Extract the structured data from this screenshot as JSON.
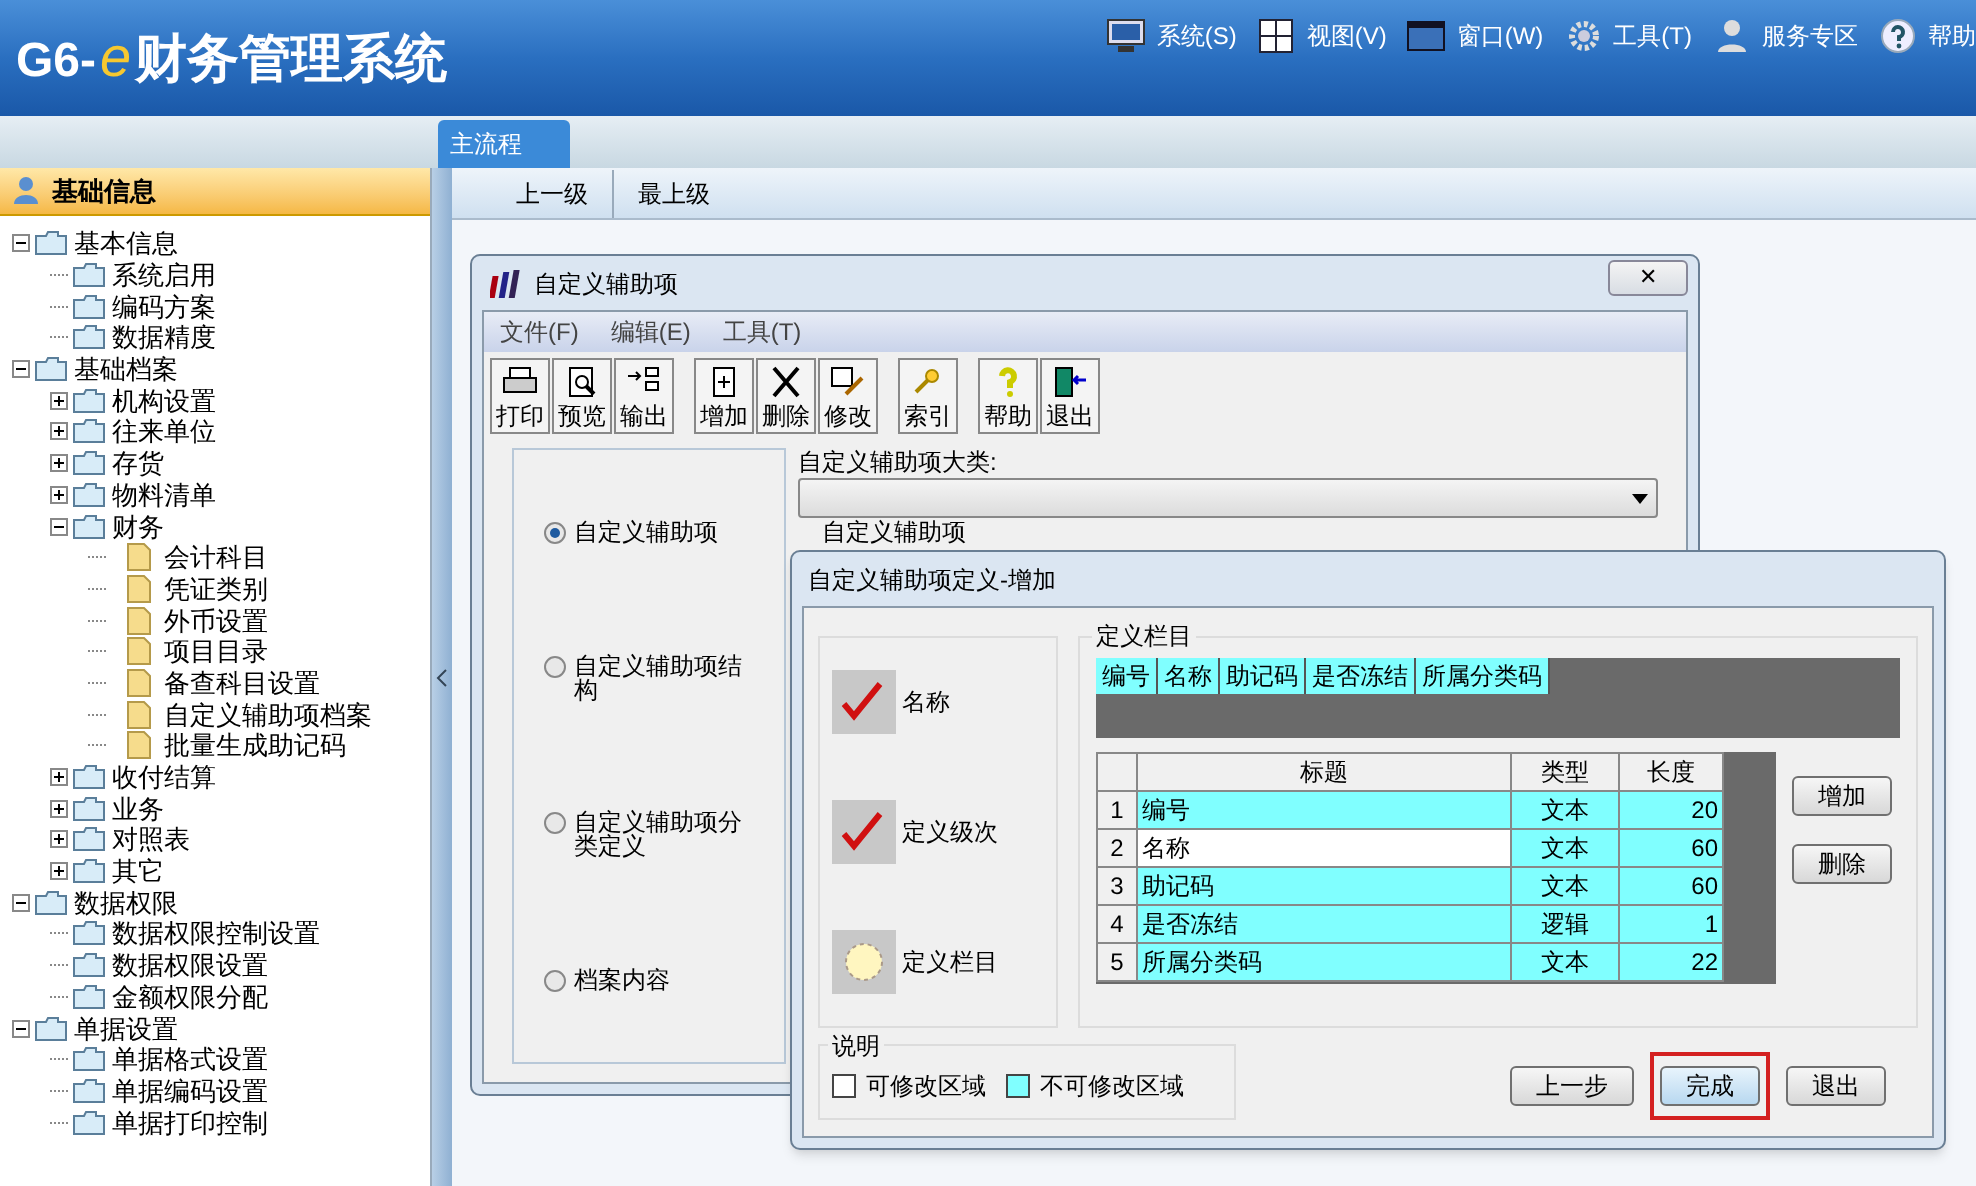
{
  "app": {
    "title_prefix": "G6-",
    "title_e": "e",
    "title": "财务管理系统"
  },
  "menu": [
    "系统(S)",
    "视图(V)",
    "窗口(W)",
    "工具(T)",
    "服务专区",
    "帮助"
  ],
  "tabs": [
    {
      "label": "主流程",
      "selected": true
    }
  ],
  "nav_buttons": [
    "上一级",
    "最上级"
  ],
  "sidebar": {
    "title": "基础信息",
    "tree": [
      {
        "label": "基本信息",
        "kind": "folder",
        "expanded": true,
        "children": [
          {
            "label": "系统启用",
            "kind": "folder"
          },
          {
            "label": "编码方案",
            "kind": "folder"
          },
          {
            "label": "数据精度",
            "kind": "folder"
          }
        ]
      },
      {
        "label": "基础档案",
        "kind": "folder",
        "expanded": true,
        "children": [
          {
            "label": "机构设置",
            "kind": "folder",
            "expanded": false
          },
          {
            "label": "往来单位",
            "kind": "folder",
            "expanded": false
          },
          {
            "label": "存货",
            "kind": "folder",
            "expanded": false
          },
          {
            "label": "物料清单",
            "kind": "folder",
            "expanded": false
          },
          {
            "label": "财务",
            "kind": "folder",
            "expanded": true,
            "children": [
              {
                "label": "会计科目",
                "kind": "document"
              },
              {
                "label": "凭证类别",
                "kind": "document"
              },
              {
                "label": "外币设置",
                "kind": "document"
              },
              {
                "label": "项目目录",
                "kind": "document"
              },
              {
                "label": "备查科目设置",
                "kind": "document"
              },
              {
                "label": "自定义辅助项档案",
                "kind": "document"
              },
              {
                "label": "批量生成助记码",
                "kind": "document"
              }
            ]
          },
          {
            "label": "收付结算",
            "kind": "folder",
            "expanded": false
          },
          {
            "label": "业务",
            "kind": "folder",
            "expanded": false
          },
          {
            "label": "对照表",
            "kind": "folder",
            "expanded": false
          },
          {
            "label": "其它",
            "kind": "folder",
            "expanded": false
          }
        ]
      },
      {
        "label": "数据权限",
        "kind": "folder",
        "expanded": true,
        "children": [
          {
            "label": "数据权限控制设置",
            "kind": "folder"
          },
          {
            "label": "数据权限设置",
            "kind": "folder"
          },
          {
            "label": "金额权限分配",
            "kind": "folder"
          }
        ]
      },
      {
        "label": "单据设置",
        "kind": "folder",
        "expanded": true,
        "children": [
          {
            "label": "单据格式设置",
            "kind": "folder"
          },
          {
            "label": "单据编码设置",
            "kind": "folder"
          },
          {
            "label": "单据打印控制",
            "kind": "folder"
          }
        ]
      }
    ]
  },
  "window": {
    "title": "自定义辅助项",
    "close": "✕",
    "menu": [
      "文件(F)",
      "编辑(E)",
      "工具(T)"
    ],
    "toolbar": [
      [
        "打印",
        "预览",
        "输出"
      ],
      [
        "增加",
        "删除",
        "修改"
      ],
      [
        "索引"
      ],
      [
        "帮助",
        "退出"
      ]
    ],
    "options": [
      {
        "label": "自定义辅助项",
        "selected": true
      },
      {
        "label": "自定义辅助项结构",
        "selected": false
      },
      {
        "label": "自定义辅助项分类定义",
        "selected": false
      },
      {
        "label": "档案内容",
        "selected": false
      }
    ],
    "category_label": "自定义辅助项大类:",
    "group_label": "自定义辅助项"
  },
  "dialog": {
    "title": "自定义辅助项定义-增加",
    "steps": [
      {
        "label": "名称",
        "checked": true
      },
      {
        "label": "定义级次",
        "checked": true
      },
      {
        "label": "定义栏目",
        "checked": false
      }
    ],
    "group_label": "定义栏目",
    "preview_columns": [
      "编号",
      "名称",
      "助记码",
      "是否冻结",
      "所属分类码"
    ],
    "table": {
      "columns": [
        "标题",
        "类型",
        "长度"
      ],
      "rows": [
        {
          "index": "1",
          "title": "编号",
          "type": "文本",
          "length": "20",
          "editable": false
        },
        {
          "index": "2",
          "title": "名称",
          "type": "文本",
          "length": "60",
          "editable": true
        },
        {
          "index": "3",
          "title": "助记码",
          "type": "文本",
          "length": "60",
          "editable": false
        },
        {
          "index": "4",
          "title": "是否冻结",
          "type": "逻辑",
          "length": "1",
          "editable": false
        },
        {
          "index": "5",
          "title": "所属分类码",
          "type": "文本",
          "length": "22",
          "editable": false
        }
      ]
    },
    "side_buttons": [
      "增加",
      "删除"
    ],
    "legend": {
      "title": "说明",
      "items": [
        {
          "label": "可修改区域",
          "editable": true
        },
        {
          "label": "不可修改区域",
          "editable": false
        }
      ]
    },
    "buttons": [
      {
        "label": "上一步",
        "highlighted": false
      },
      {
        "label": "完成",
        "highlighted": true
      },
      {
        "label": "退出",
        "highlighted": false
      }
    ]
  }
}
